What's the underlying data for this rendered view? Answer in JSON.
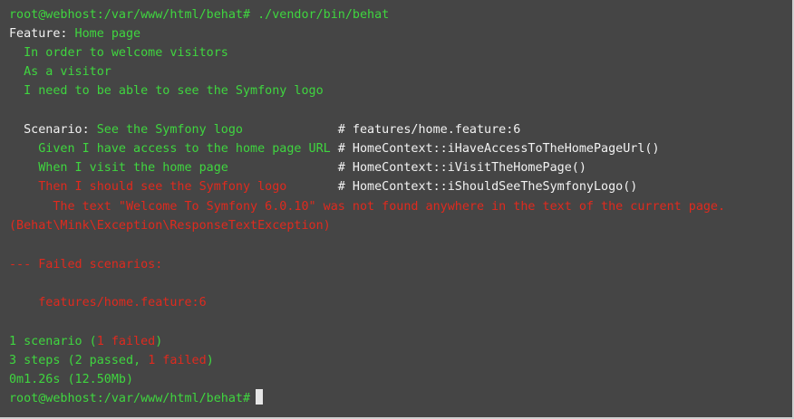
{
  "terminal": {
    "command": {
      "prompt": "root@webhost:/var/www/html/behat#",
      "text": " ./vendor/bin/behat"
    },
    "feature": {
      "keyword": "Feature:",
      "title": " Home page",
      "narrative": [
        "  In order to welcome visitors",
        "  As a visitor",
        "  I need to be able to see the Symfony logo"
      ]
    },
    "scenario": {
      "keyword": "  Scenario:",
      "title": " See the Symfony logo             ",
      "location": "# features/home.feature:6"
    },
    "steps": [
      {
        "text": "    Given I have access to the home page URL ",
        "location": "# HomeContext::iHaveAccessToTheHomePageUrl()",
        "status": "passed"
      },
      {
        "text": "    When I visit the home page               ",
        "location": "# HomeContext::iVisitTheHomePage()",
        "status": "passed"
      },
      {
        "text": "    Then I should see the Symfony logo       ",
        "location": "# HomeContext::iShouldSeeTheSymfonyLogo()",
        "status": "failed"
      }
    ],
    "error": {
      "message": "      The text \"Welcome To Symfony 6.0.10\" was not found anywhere in the text of the current page.",
      "exception": "(Behat\\Mink\\Exception\\ResponseTextException)"
    },
    "failed": {
      "header": "--- Failed scenarios:",
      "item": "    features/home.feature:6"
    },
    "summary": {
      "scenarios": {
        "pre": "1 scenario (",
        "failed": "1 failed",
        "post": ")"
      },
      "steps": {
        "pre": "3 steps (",
        "passed": "2 passed",
        "sep": ", ",
        "failed": "1 failed",
        "post": ")"
      },
      "time": "0m1.26s (12.50Mb)"
    },
    "final_prompt": "root@webhost:/var/www/html/behat#"
  },
  "colors": {
    "background": "#454545",
    "passed": "#3fd63f",
    "failed": "#e02a1e",
    "keyword": "#f2f2f2"
  }
}
